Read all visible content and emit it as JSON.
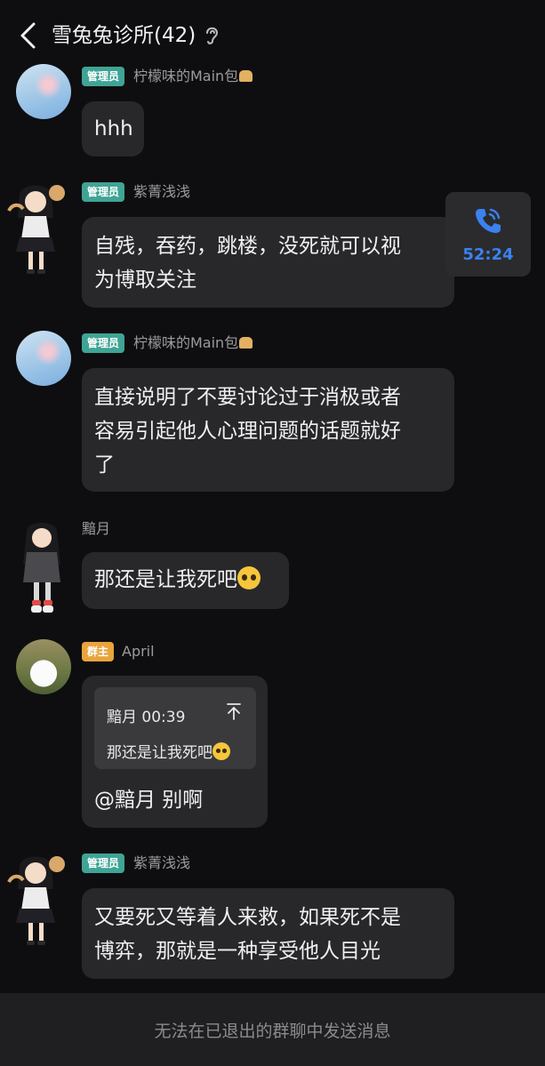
{
  "header": {
    "title": "雪兔兔诊所(42)"
  },
  "calls": {
    "duration": "52:24"
  },
  "messages": [
    {
      "role": "管理员",
      "name": "柠檬味的Main包",
      "text": "hhh"
    },
    {
      "role": "管理员",
      "name": "紫菁浅浅",
      "lines": [
        "自残，吞药，跳楼，没死就可以视",
        "为博取关注"
      ]
    },
    {
      "role": "管理员",
      "name": "柠檬味的Main包",
      "lines": [
        "直接说明了不要讨论过于消极或者",
        "容易引起他人心理问题的话题就好",
        "了"
      ]
    },
    {
      "name": "黯月",
      "text": "那还是让我死吧"
    },
    {
      "role": "群主",
      "name": "April",
      "quote": {
        "header": "黯月 00:39",
        "text": "那还是让我死吧"
      },
      "text": "@黯月 别啊"
    },
    {
      "role": "管理员",
      "name": "紫菁浅浅",
      "lines": [
        "又要死又等着人来救，如果死不是",
        "博弈，那就是一种享受他人目光"
      ]
    }
  ],
  "footer": {
    "notice": "无法在已退出的群聊中发送消息"
  },
  "icons": {
    "back": "chevron-left-icon",
    "ear": "ear-icon",
    "call": "phone-icon",
    "quote_jump": "arrow-up-icon",
    "emoji": "pleading-face-emoji",
    "bread": "bread-emoji"
  },
  "colors": {
    "admin_badge": "#3fa495",
    "owner_badge": "#e9a43c",
    "call_accent": "#3a82f0"
  }
}
